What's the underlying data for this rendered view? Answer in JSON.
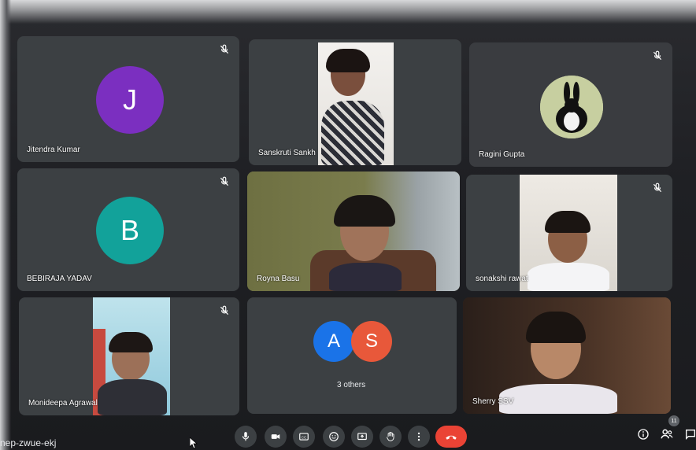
{
  "meeting": {
    "code": "nep-zwue-ekj",
    "participant_count": "11"
  },
  "tiles": {
    "jitendra": {
      "name": "Jitendra Kumar",
      "initial": "J",
      "color": "#7b2fc0"
    },
    "sanskruti": {
      "name": "Sanskruti Sankh"
    },
    "ragini": {
      "name": "Ragini Gupta"
    },
    "bebiraja": {
      "name": "BEBIRAJA YADAV",
      "initial": "B",
      "color": "#12a29a"
    },
    "royna": {
      "name": "Royna Basu"
    },
    "sonakshi": {
      "name": "sonakshi rawat"
    },
    "monideepa": {
      "name": "Monideepa Agrawal"
    },
    "others": {
      "label": "3 others",
      "initial_a": "A",
      "initial_s": "S",
      "color_a": "#1a73e8",
      "color_s": "#e8583a"
    },
    "sherry": {
      "name": "Sherry SSV"
    }
  },
  "controls": {
    "items": [
      "microphone-icon",
      "camera-icon",
      "captions-icon",
      "emoji-icon",
      "present-icon",
      "raise-hand-icon",
      "more-options-icon",
      "end-call-icon"
    ],
    "right_items": [
      "info-icon",
      "people-icon",
      "chat-icon"
    ],
    "end_call_color": "#ea4335",
    "tile_color": "#3c4043"
  }
}
